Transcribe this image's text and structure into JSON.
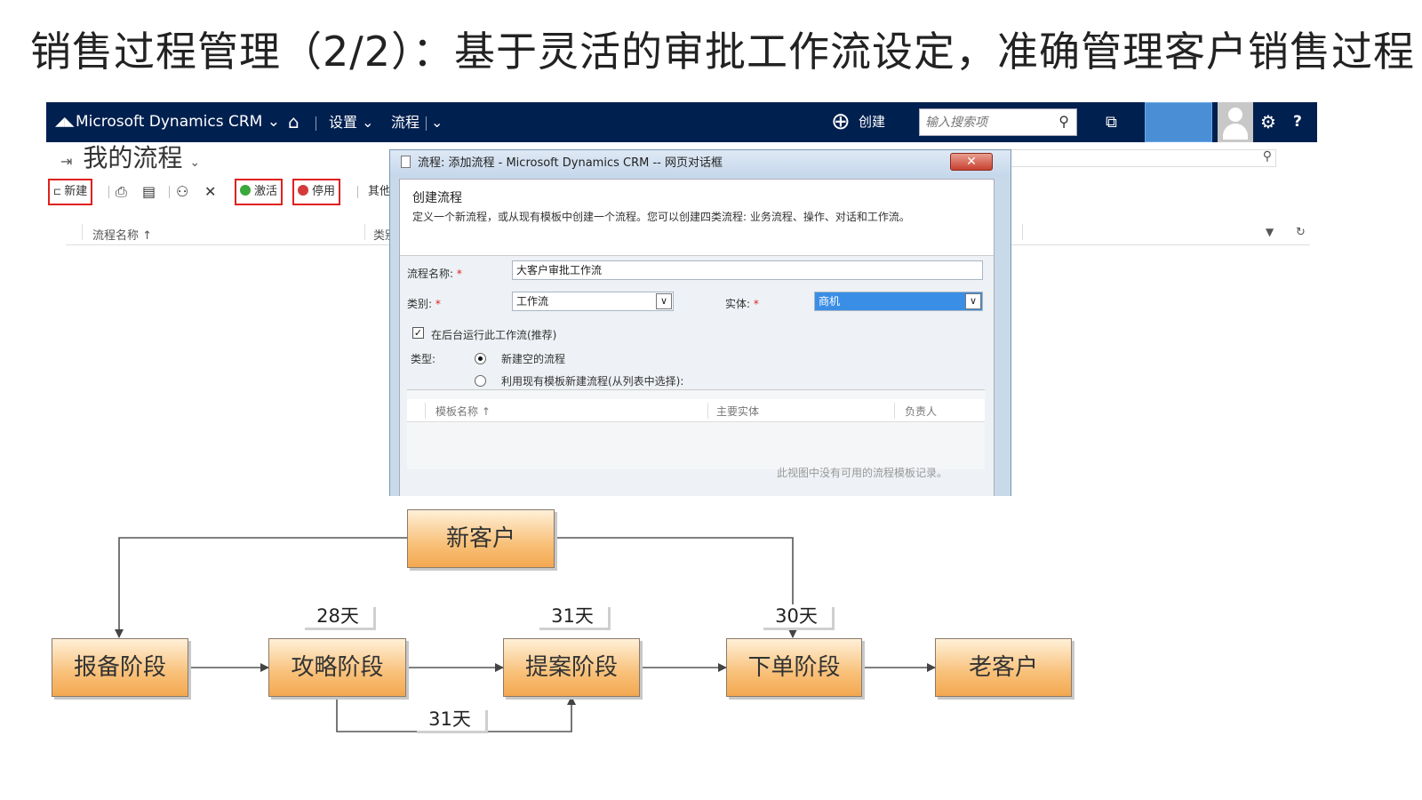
{
  "slide": {
    "title": "销售过程管理（2/2）：基于灵活的审批工作流设定，准确管理客户销售过程"
  },
  "crm": {
    "nav": {
      "brand": "Microsoft Dynamics CRM",
      "brand_chevron": "⌄",
      "home_icon": "⌂",
      "settings_label": "设置",
      "settings_chevron": "⌄",
      "process_label": "流程",
      "process_chevron": "⌄",
      "create_icon": "⊕",
      "create_label": "创建",
      "search_placeholder": "输入搜索项",
      "search_icon": "⚲",
      "recent_icon": "⧉",
      "gear_icon": "⚙",
      "help_icon": "?"
    },
    "page_header": {
      "pin_icon": "⇥",
      "title": "我的流程",
      "chevron": "⌄"
    },
    "toolbar": {
      "new_label": "新建",
      "print_icon": "⎙",
      "copy_icon": "▤",
      "assign_icon": "⚇",
      "delete_icon": "✕",
      "activate_label": "激活",
      "deactivate_label": "停用",
      "more_label": "其他"
    },
    "grid": {
      "col_name": "流程名称 ↑",
      "col_category": "类别",
      "filter_icon": "▼",
      "refresh_icon": "↻",
      "search_icon": "⚲"
    },
    "colors": {
      "nav_bg": "#002050",
      "highlight_border": "#e02020",
      "accent_blue": "#4a8fd6"
    }
  },
  "dialog": {
    "title": "流程: 添加流程 - Microsoft Dynamics CRM -- 网页对话框",
    "close_label": "✕",
    "heading": "创建流程",
    "description": "定义一个新流程，或从现有模板中创建一个流程。您可以创建四类流程: 业务流程、操作、对话和工作流。",
    "name_label": "流程名称:",
    "name_value": "大客户审批工作流",
    "category_label": "类别:",
    "category_value": "工作流",
    "entity_label": "实体:",
    "entity_value": "商机",
    "dropdown_arrow": "∨",
    "required_mark": "*",
    "background_run_label": "在后台运行此工作流(推荐)",
    "background_run_checked": "✓",
    "type_label": "类型:",
    "type_option_new": "新建空的流程",
    "type_option_template": "利用现有模板新建流程(从列表中选择):",
    "tpl_col_name": "模板名称 ↑",
    "tpl_col_entity": "主要实体",
    "tpl_col_owner": "负责人",
    "tpl_empty": "此视图中没有可用的流程模板记录。"
  },
  "flow": {
    "start": "新客户",
    "stages": [
      "报备阶段",
      "攻略阶段",
      "提案阶段",
      "下单阶段",
      "老客户"
    ],
    "durations": {
      "d1": "28天",
      "d2": "31天",
      "d3": "30天",
      "d_back": "31天"
    }
  }
}
